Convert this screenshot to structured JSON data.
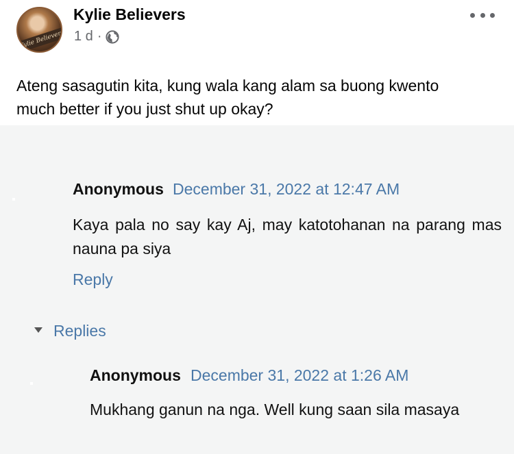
{
  "post": {
    "author": "Kylie Believers",
    "time": "1 d",
    "separator": "·",
    "privacy_icon": "globe-icon",
    "more_icon": "more-options-icon",
    "caption_line1": "Ateng sasagutin kita, kung wala kang alam sa buong kwento",
    "caption_line2": "much better if you just shut up okay?"
  },
  "comment": {
    "author": "Anonymous",
    "date": "December 31, 2022 at 12:47 AM",
    "body": "Kaya pala no say kay Aj, may katotohanan na parang mas nauna pa siya",
    "reply_label": "Reply"
  },
  "replies": {
    "toggle_label": "Replies",
    "items": [
      {
        "author": "Anonymous",
        "date": "December 31, 2022 at 1:26 AM",
        "body": "Mukhang ganun na nga. Well kung saan sila masaya"
      }
    ]
  },
  "colors": {
    "link": "#4a78a8",
    "panel_bg": "#f4f5f5",
    "meta_gray": "#65676b"
  }
}
